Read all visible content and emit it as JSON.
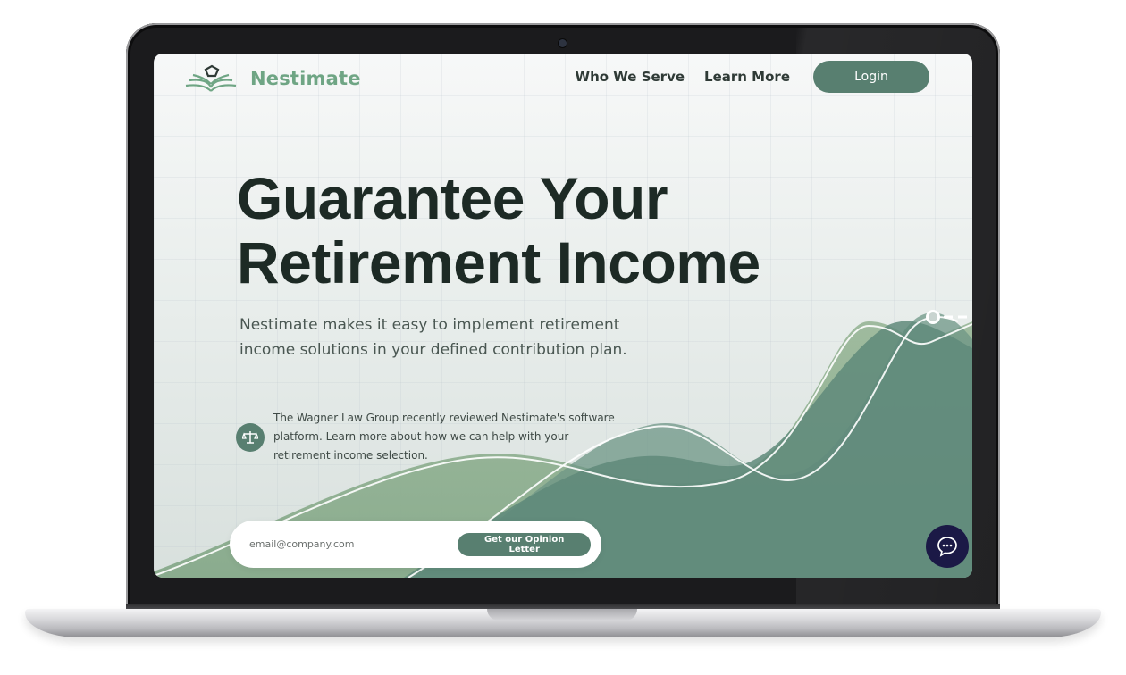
{
  "brand": {
    "name": "Nestimate",
    "accent": "#6fa584",
    "primary": "#587f70",
    "dark_text": "#1d2a25"
  },
  "nav": {
    "links": [
      {
        "label": "Who We Serve"
      },
      {
        "label": "Learn More"
      }
    ],
    "login_label": "Login"
  },
  "hero": {
    "headline_line1": "Guarantee Your",
    "headline_line2": "Retirement Income",
    "subhead": "Nestimate makes it easy to implement retirement income solutions in your defined contribution plan."
  },
  "review": {
    "icon": "scales-icon",
    "text": "The Wagner Law Group recently reviewed Nestimate's software platform. Learn more about how we can help with your retirement income selection."
  },
  "signup": {
    "email_placeholder": "email@company.com",
    "cta_label": "Get our Opinion Letter"
  },
  "chat": {
    "icon": "chat-bubble-icon",
    "color": "#1b1946"
  }
}
